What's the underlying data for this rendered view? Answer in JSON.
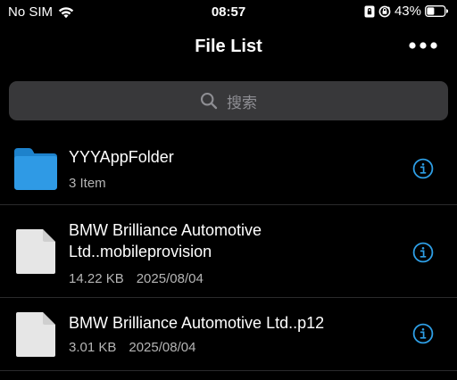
{
  "status_bar": {
    "carrier": "No SIM",
    "time": "08:57",
    "battery_percent": "43%",
    "battery_level": 0.43,
    "icons": [
      "wifi-icon",
      "portrait-lock-icon",
      "orientation-lock-icon",
      "battery-icon"
    ]
  },
  "nav": {
    "title": "File List",
    "more_icon": "ellipsis-icon"
  },
  "search": {
    "placeholder": "搜索",
    "icon": "search-icon"
  },
  "files": [
    {
      "type": "folder",
      "name_lines": [
        "YYYAppFolder"
      ],
      "meta": [
        "3 Item"
      ],
      "icon": "folder-icon"
    },
    {
      "type": "file",
      "name_lines": [
        "BMW Brilliance Automotive",
        "Ltd..mobileprovision"
      ],
      "meta": [
        "14.22 KB",
        "2025/08/04"
      ],
      "icon": "document-icon"
    },
    {
      "type": "file",
      "name_lines": [
        "BMW Brilliance Automotive Ltd..p12"
      ],
      "meta": [
        "3.01 KB",
        "2025/08/04"
      ],
      "icon": "document-icon"
    }
  ],
  "colors": {
    "background": "#000000",
    "accent": "#2e9fe6",
    "folder": "#2f9ae5",
    "search_bg": "#38383a",
    "secondary_text": "#b5b5b5"
  }
}
